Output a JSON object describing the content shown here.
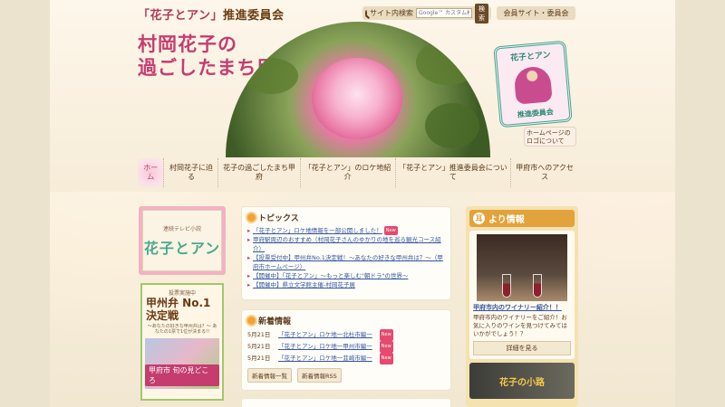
{
  "header": {
    "committee_title_pre": "「花子とアン」",
    "committee_title_post": "推進委員会",
    "site_title_line1": "村岡花子の",
    "site_title_line2": "過ごしたまち甲府"
  },
  "search": {
    "label": "サイト内検索",
    "placeholder": "Google™ カスタム検索",
    "button": "検索"
  },
  "member_link": "会員サイト・委員会",
  "logo_badge": {
    "top": "花子とアン",
    "bottom": "推進委員会"
  },
  "logo_about": "ホームページのロゴについて",
  "nav": {
    "items": [
      {
        "label": "ホーム"
      },
      {
        "label": "村岡花子に迫る"
      },
      {
        "label": "花子の過ごしたまち甲府"
      },
      {
        "label": "「花子とアン」のロケ地紹介"
      },
      {
        "label": "「花子とアン」推進委員会について"
      },
      {
        "label": "甲府市へのアクセス"
      }
    ]
  },
  "banner_asadora": {
    "small": "連続テレビ小説",
    "big": "花子とアン"
  },
  "banner_ben": {
    "l1": "投票実施中",
    "l2": "甲州弁 No.1 決定戦",
    "l3": "～あなたの好きな甲州弁は？～ あなたの1票で1位が決まる!!",
    "photo_label": "甲府市 旬の見どころ"
  },
  "topics": {
    "title": "トピックス",
    "new_label": "New",
    "items": [
      {
        "text": "「花子とアン」ロケ地情報を一部公開しました！",
        "new": true
      },
      {
        "text": "甲府駅周辺のおすすめ（村岡花子さんのゆかりの地を巡る観光コース紹介）",
        "new": false
      },
      {
        "text": "【投票受付中】甲州弁No.1決定戦！～あなたの好きな甲州弁は？～（甲府市ホームページ）",
        "new": false
      },
      {
        "text": "【開催中】「花子とアン」～もっと楽しむ\"朝ドラ\"の世界～",
        "new": false
      },
      {
        "text": "【開催中】県立文学館主催-村岡花子展",
        "new": false
      }
    ]
  },
  "news": {
    "title": "新着情報",
    "new_label": "New",
    "rows": [
      {
        "date": "5月21日",
        "text": "「花子とアン」ロケ地一北杜市編一"
      },
      {
        "date": "5月21日",
        "text": "「花子とアン」ロケ地一甲州市編一"
      },
      {
        "date": "5月21日",
        "text": "「花子とアン」ロケ地一韮崎市編一"
      }
    ],
    "list_button": "新着情報一覧",
    "rss_button": "新着情報RSS"
  },
  "mimi": {
    "ear": "耳",
    "title": "より情報",
    "link": "甲府市内のワイナリー紹介！！",
    "text": "甲府市内のワイナリーをご紹介！お気に入りのワインを見つけてみてはいかがでしょう！？",
    "detail": "詳細を見る",
    "komichi": "花子の小路"
  }
}
